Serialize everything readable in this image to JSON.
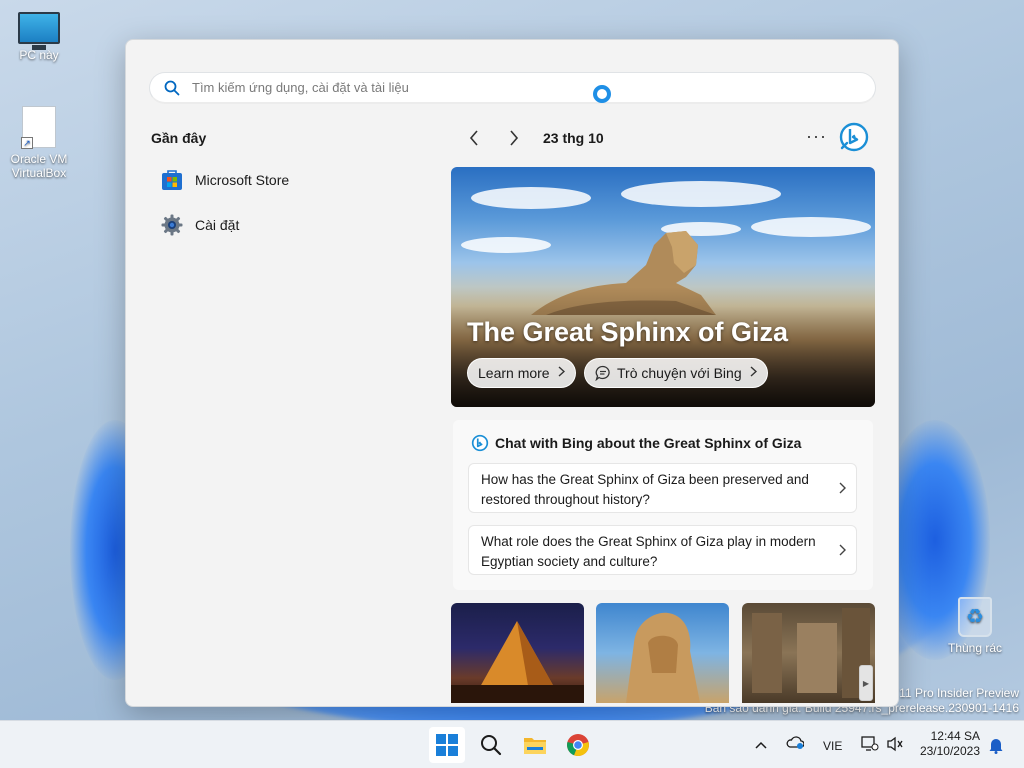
{
  "desktop": {
    "icons": [
      {
        "label": "PC này"
      },
      {
        "label": "Oracle VM VirtualBox"
      },
      {
        "label": "Thùng rác"
      }
    ],
    "watermark": {
      "line1": "11 Pro Insider Preview",
      "line2": "Bản sao đánh giá. Build 25947.rs_prerelease.230901-1416"
    }
  },
  "search": {
    "placeholder": "Tìm kiếm ứng dụng, cài đặt và tài liệu",
    "value": ""
  },
  "recent": {
    "title": "Gần đây",
    "items": [
      {
        "label": "Microsoft Store",
        "icon": "microsoft-store-icon"
      },
      {
        "label": "Cài đặt",
        "icon": "settings-gear-icon"
      }
    ]
  },
  "highlights": {
    "date": "23 thg 10",
    "more": "···",
    "hero": {
      "title": "The Great Sphinx of Giza",
      "learn_more": "Learn more",
      "chat_bing": "Trò chuyện với Bing"
    },
    "chat": {
      "heading": "Chat with Bing about the Great Sphinx of Giza",
      "questions": [
        "How has the Great Sphinx of Giza been preserved and restored throughout history?",
        "What role does the Great Sphinx of Giza play in modern Egyptian society and culture?"
      ]
    }
  },
  "taskbar": {
    "language": "VIE",
    "time": "12:44 SA",
    "date": "23/10/2023"
  },
  "colors": {
    "accent": "#0067c0",
    "bing_blue": "#1b8fd6",
    "flyout_bg": "#f3f3f3"
  }
}
